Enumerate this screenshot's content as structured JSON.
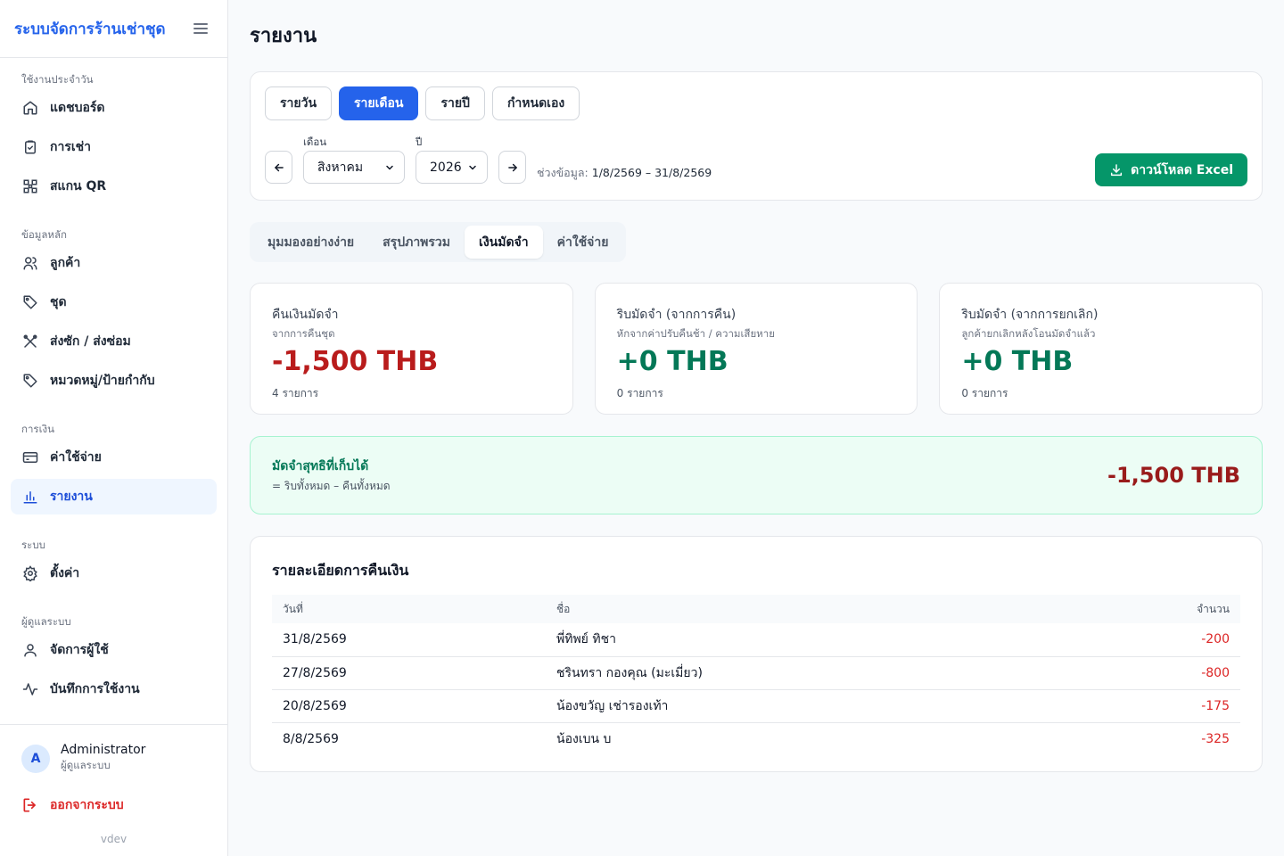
{
  "app": {
    "title": "ระบบจัดการร้านเช่าชุด",
    "version": "vdev"
  },
  "sidebar": {
    "sections": [
      {
        "label": "ใช้งานประจำวัน",
        "items": [
          {
            "label": "แดชบอร์ด",
            "icon": "home-icon"
          },
          {
            "label": "การเช่า",
            "icon": "clipboard-icon"
          },
          {
            "label": "สแกน QR",
            "icon": "qr-icon"
          }
        ]
      },
      {
        "label": "ข้อมูลหลัก",
        "items": [
          {
            "label": "ลูกค้า",
            "icon": "users-icon"
          },
          {
            "label": "ชุด",
            "icon": "tag-icon"
          },
          {
            "label": "ส่งซัก / ส่งซ่อม",
            "icon": "tools-icon"
          },
          {
            "label": "หมวดหมู่/ป้ายกำกับ",
            "icon": "label-icon"
          }
        ]
      },
      {
        "label": "การเงิน",
        "items": [
          {
            "label": "ค่าใช้จ่าย",
            "icon": "card-icon"
          },
          {
            "label": "รายงาน",
            "icon": "bar-chart-icon"
          }
        ]
      },
      {
        "label": "ระบบ",
        "items": [
          {
            "label": "ตั้งค่า",
            "icon": "gear-icon"
          }
        ]
      },
      {
        "label": "ผู้ดูแลระบบ",
        "items": [
          {
            "label": "จัดการผู้ใช้",
            "icon": "user-icon"
          },
          {
            "label": "บันทึกการใช้งาน",
            "icon": "activity-icon"
          }
        ]
      }
    ],
    "user": {
      "initial": "A",
      "name": "Administrator",
      "role": "ผู้ดูแลระบบ"
    },
    "logout_label": "ออกจากระบบ"
  },
  "page": {
    "title": "รายงาน"
  },
  "filters": {
    "period_tabs": [
      "รายวัน",
      "รายเดือน",
      "รายปี",
      "กำหนดเอง"
    ],
    "active_period": "รายเดือน",
    "month_label": "เดือน",
    "month_value": "สิงหาคม",
    "year_label": "ปี",
    "year_value": "2026",
    "range_label": "ช่วงข้อมูล:",
    "range_value": "1/8/2569 – 31/8/2569",
    "excel_label": "ดาวน์โหลด Excel"
  },
  "view_tabs": [
    "มุมมองอย่างง่าย",
    "สรุปภาพรวม",
    "เงินมัดจำ",
    "ค่าใช้จ่าย"
  ],
  "active_view": "เงินมัดจำ",
  "stats": [
    {
      "title": "คืนเงินมัดจำ",
      "subtitle": "จากการคืนชุด",
      "value": "-1,500 THB",
      "count": "4 รายการ",
      "tone": "neg"
    },
    {
      "title": "ริบมัดจำ (จากการคืน)",
      "subtitle": "หักจากค่าปรับคืนช้า / ความเสียหาย",
      "value": "+0 THB",
      "count": "0 รายการ",
      "tone": "pos"
    },
    {
      "title": "ริบมัดจำ (จากการยกเลิก)",
      "subtitle": "ลูกค้ายกเลิกหลังโอนมัดจำแล้ว",
      "value": "+0 THB",
      "count": "0 รายการ",
      "tone": "pos"
    }
  ],
  "net": {
    "title": "มัดจำสุทธิที่เก็บได้",
    "subtitle": "= ริบทั้งหมด – คืนทั้งหมด",
    "value": "-1,500 THB"
  },
  "detail": {
    "title": "รายละเอียดการคืนเงิน",
    "columns": [
      "วันที่",
      "ชื่อ",
      "จำนวน"
    ],
    "rows": [
      {
        "date": "31/8/2569",
        "name": "พี่ทิพย์ ทิชา",
        "amount": "-200"
      },
      {
        "date": "27/8/2569",
        "name": "ชรินทรา กองคุณ (มะเมี่ยว)",
        "amount": "-800"
      },
      {
        "date": "20/8/2569",
        "name": "น้องขวัญ เช่ารองเท้า",
        "amount": "-175"
      },
      {
        "date": "8/8/2569",
        "name": "น้องเบน บ",
        "amount": "-325"
      }
    ]
  }
}
